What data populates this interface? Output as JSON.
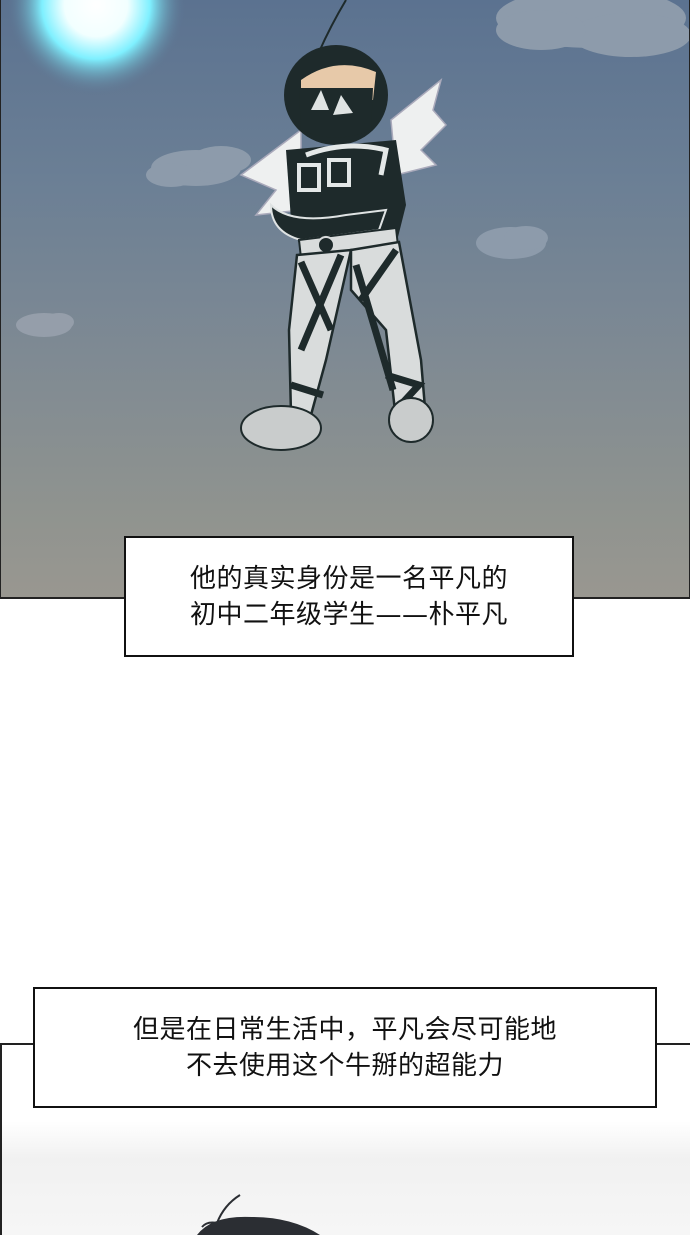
{
  "captions": {
    "first": {
      "line1": "他的真实身份是一名平凡的",
      "line2": "初中二年级学生——朴平凡"
    },
    "second": {
      "line1": "但是在日常生活中，平凡会尽可能地",
      "line2": "不去使用这个牛掰的超能力"
    }
  },
  "colors": {
    "sky_top": "#5b7290",
    "sky_bottom": "#999790",
    "suit_dark": "#1e2a2b",
    "suit_light": "#d9dcdc",
    "caption_border": "#111111"
  }
}
